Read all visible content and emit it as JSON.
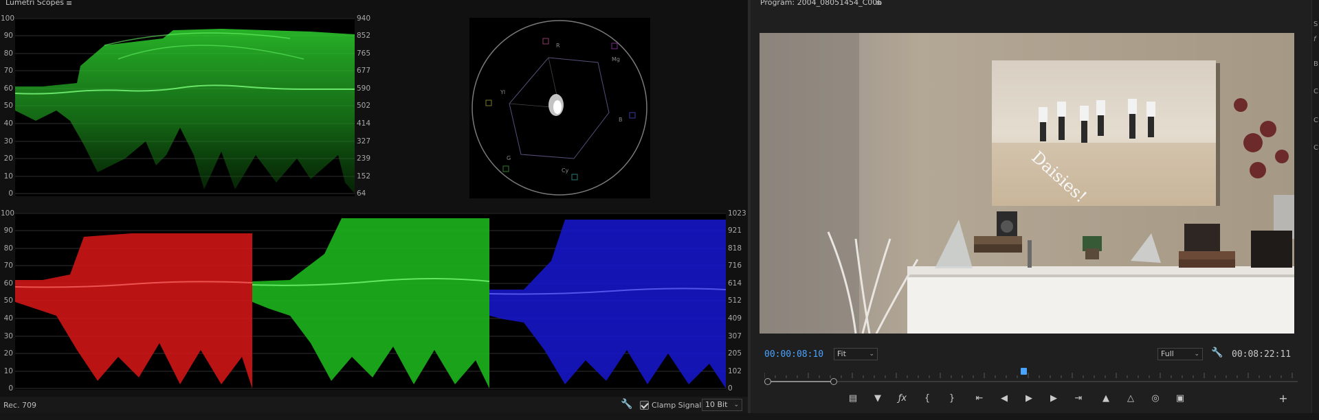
{
  "scopes": {
    "title": "Lumetri Scopes",
    "menu_icon": "hamburger-icon",
    "luma_left_scale": [
      "100",
      "90",
      "80",
      "70",
      "60",
      "50",
      "40",
      "30",
      "20",
      "10",
      "0"
    ],
    "luma_right_scale": [
      "940",
      "852",
      "765",
      "677",
      "590",
      "502",
      "414",
      "327",
      "239",
      "152",
      "64"
    ],
    "parade_left_scale": [
      "100",
      "90",
      "80",
      "70",
      "60",
      "50",
      "40",
      "30",
      "20",
      "10",
      "0"
    ],
    "parade_right_scale": [
      "1023",
      "921",
      "818",
      "716",
      "614",
      "512",
      "409",
      "307",
      "205",
      "102",
      "0"
    ],
    "vectorscope_labels": [
      "R",
      "Mg",
      "B",
      "Cy",
      "G",
      "Yl"
    ],
    "footer": {
      "colorspace": "Rec. 709",
      "clamp_label": "Clamp Signal",
      "clamp_checked": true,
      "bit_depth": "10 Bit"
    },
    "colors": {
      "luma": "#2ed02e",
      "red": "#e01818",
      "green": "#22c522",
      "blue": "#1a1ae0"
    }
  },
  "program": {
    "title": "Program: 2004_08051454_C006",
    "menu_icon": "hamburger-icon",
    "overlay_text": "Daisies!",
    "current_timecode": "00:00:08:10",
    "zoom_select": "Fit",
    "quality_select": "Full",
    "duration_timecode": "00:08:22:11",
    "accent_color": "#4aa3ff"
  },
  "right_edge_letters": [
    "S",
    "f",
    "B",
    "C",
    "C",
    "C"
  ]
}
